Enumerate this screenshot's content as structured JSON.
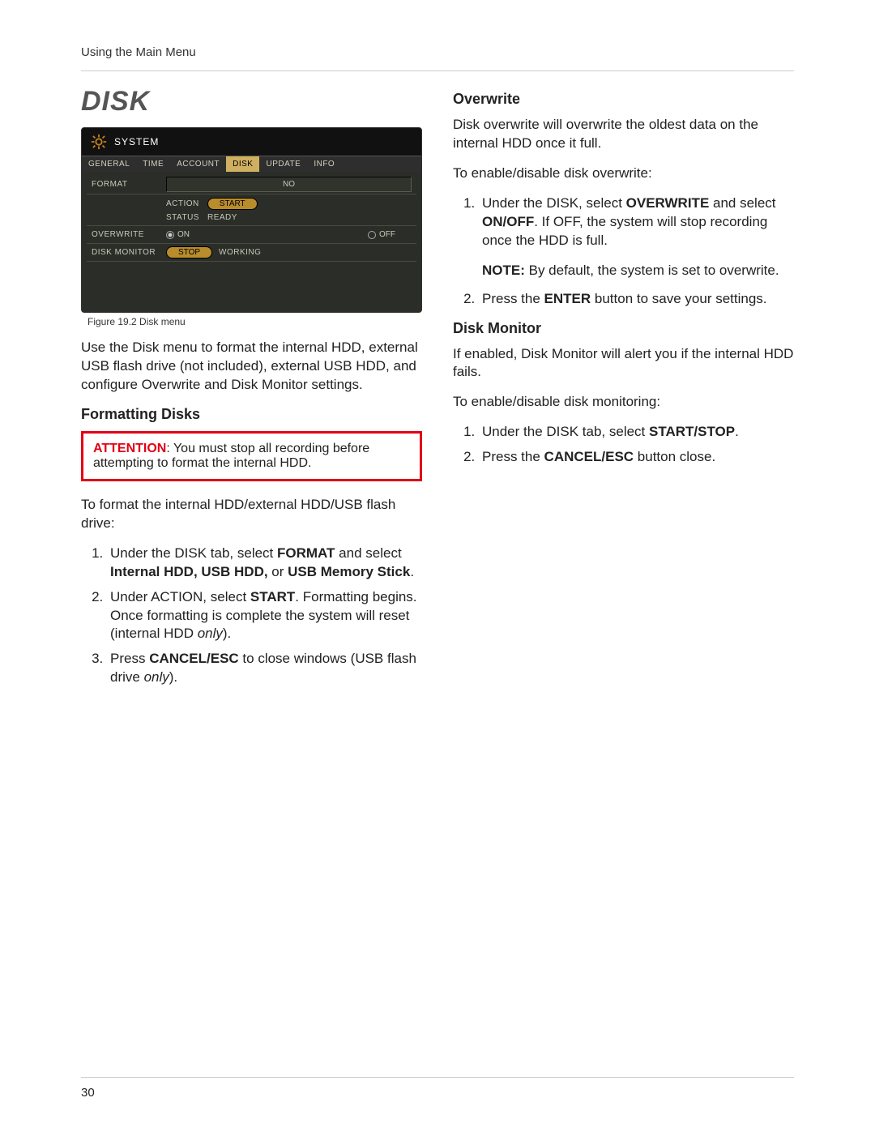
{
  "running_head": "Using the Main Menu",
  "page_number": "30",
  "left": {
    "title": "DISK",
    "caption": "Figure 19.2 Disk menu",
    "intro": "Use the Disk menu to format the internal HDD, external USB flash drive (not included), external USB HDD, and configure Overwrite and Disk Monitor settings.",
    "format_head": "Formatting Disks",
    "warn_label": "ATTENTION",
    "warn_text": ": You must stop all recording before attempting to format the internal HDD.",
    "format_lead": "To format the internal HDD/external HDD/USB flash drive:",
    "steps": {
      "s1a": "Under the DISK tab, select ",
      "s1b": "FORMAT",
      "s1c": " and select ",
      "s1d": "Internal HDD, USB HDD,",
      "s1e": " or ",
      "s1f": "USB Memory Stick",
      "s1g": ".",
      "s2a": "Under ACTION, select ",
      "s2b": "START",
      "s2c": ". Formatting begins. Once formatting is complete the system will reset (internal HDD ",
      "s2d": "only",
      "s2e": ").",
      "s3a": "Press ",
      "s3b": "CANCEL/ESC",
      "s3c": " to close windows (USB flash drive ",
      "s3d": "only",
      "s3e": ")."
    }
  },
  "right": {
    "ow_head": "Overwrite",
    "ow_p1": "Disk overwrite will overwrite the oldest data on the internal HDD once it full.",
    "ow_p2": "To enable/disable disk overwrite:",
    "ow_steps": {
      "s1a": "Under the DISK, select ",
      "s1b": "OVERWRITE",
      "s1c": " and select ",
      "s1d": "ON/OFF",
      "s1e": ". If OFF, the system will stop recording once the HDD is full.",
      "s2a": "Press the ",
      "s2b": "ENTER",
      "s2c": " button to save your settings."
    },
    "ow_note_a": "NOTE:",
    "ow_note_b": " By default, the system is set to overwrite.",
    "dm_head": "Disk Monitor",
    "dm_p1": "If enabled, Disk Monitor will alert you if the internal HDD fails.",
    "dm_p2": "To enable/disable disk monitoring:",
    "dm_steps": {
      "s1a": "Under the DISK tab, select ",
      "s1b": "START/STOP",
      "s1c": ".",
      "s2a": "Press the ",
      "s2b": "CANCEL/ESC",
      "s2c": " button close."
    }
  },
  "shot": {
    "title": "SYSTEM",
    "tabs": [
      "GENERAL",
      "TIME",
      "ACCOUNT",
      "DISK",
      "UPDATE",
      "INFO"
    ],
    "active_tab": 3,
    "rows": {
      "format": "FORMAT",
      "format_val": "NO",
      "action": "ACTION",
      "start": "START",
      "status": "STATUS",
      "ready": "READY",
      "overwrite": "OVERWRITE",
      "on": "ON",
      "off": "OFF",
      "monitor": "DISK MONITOR",
      "stop": "STOP",
      "working": "WORKING"
    }
  }
}
